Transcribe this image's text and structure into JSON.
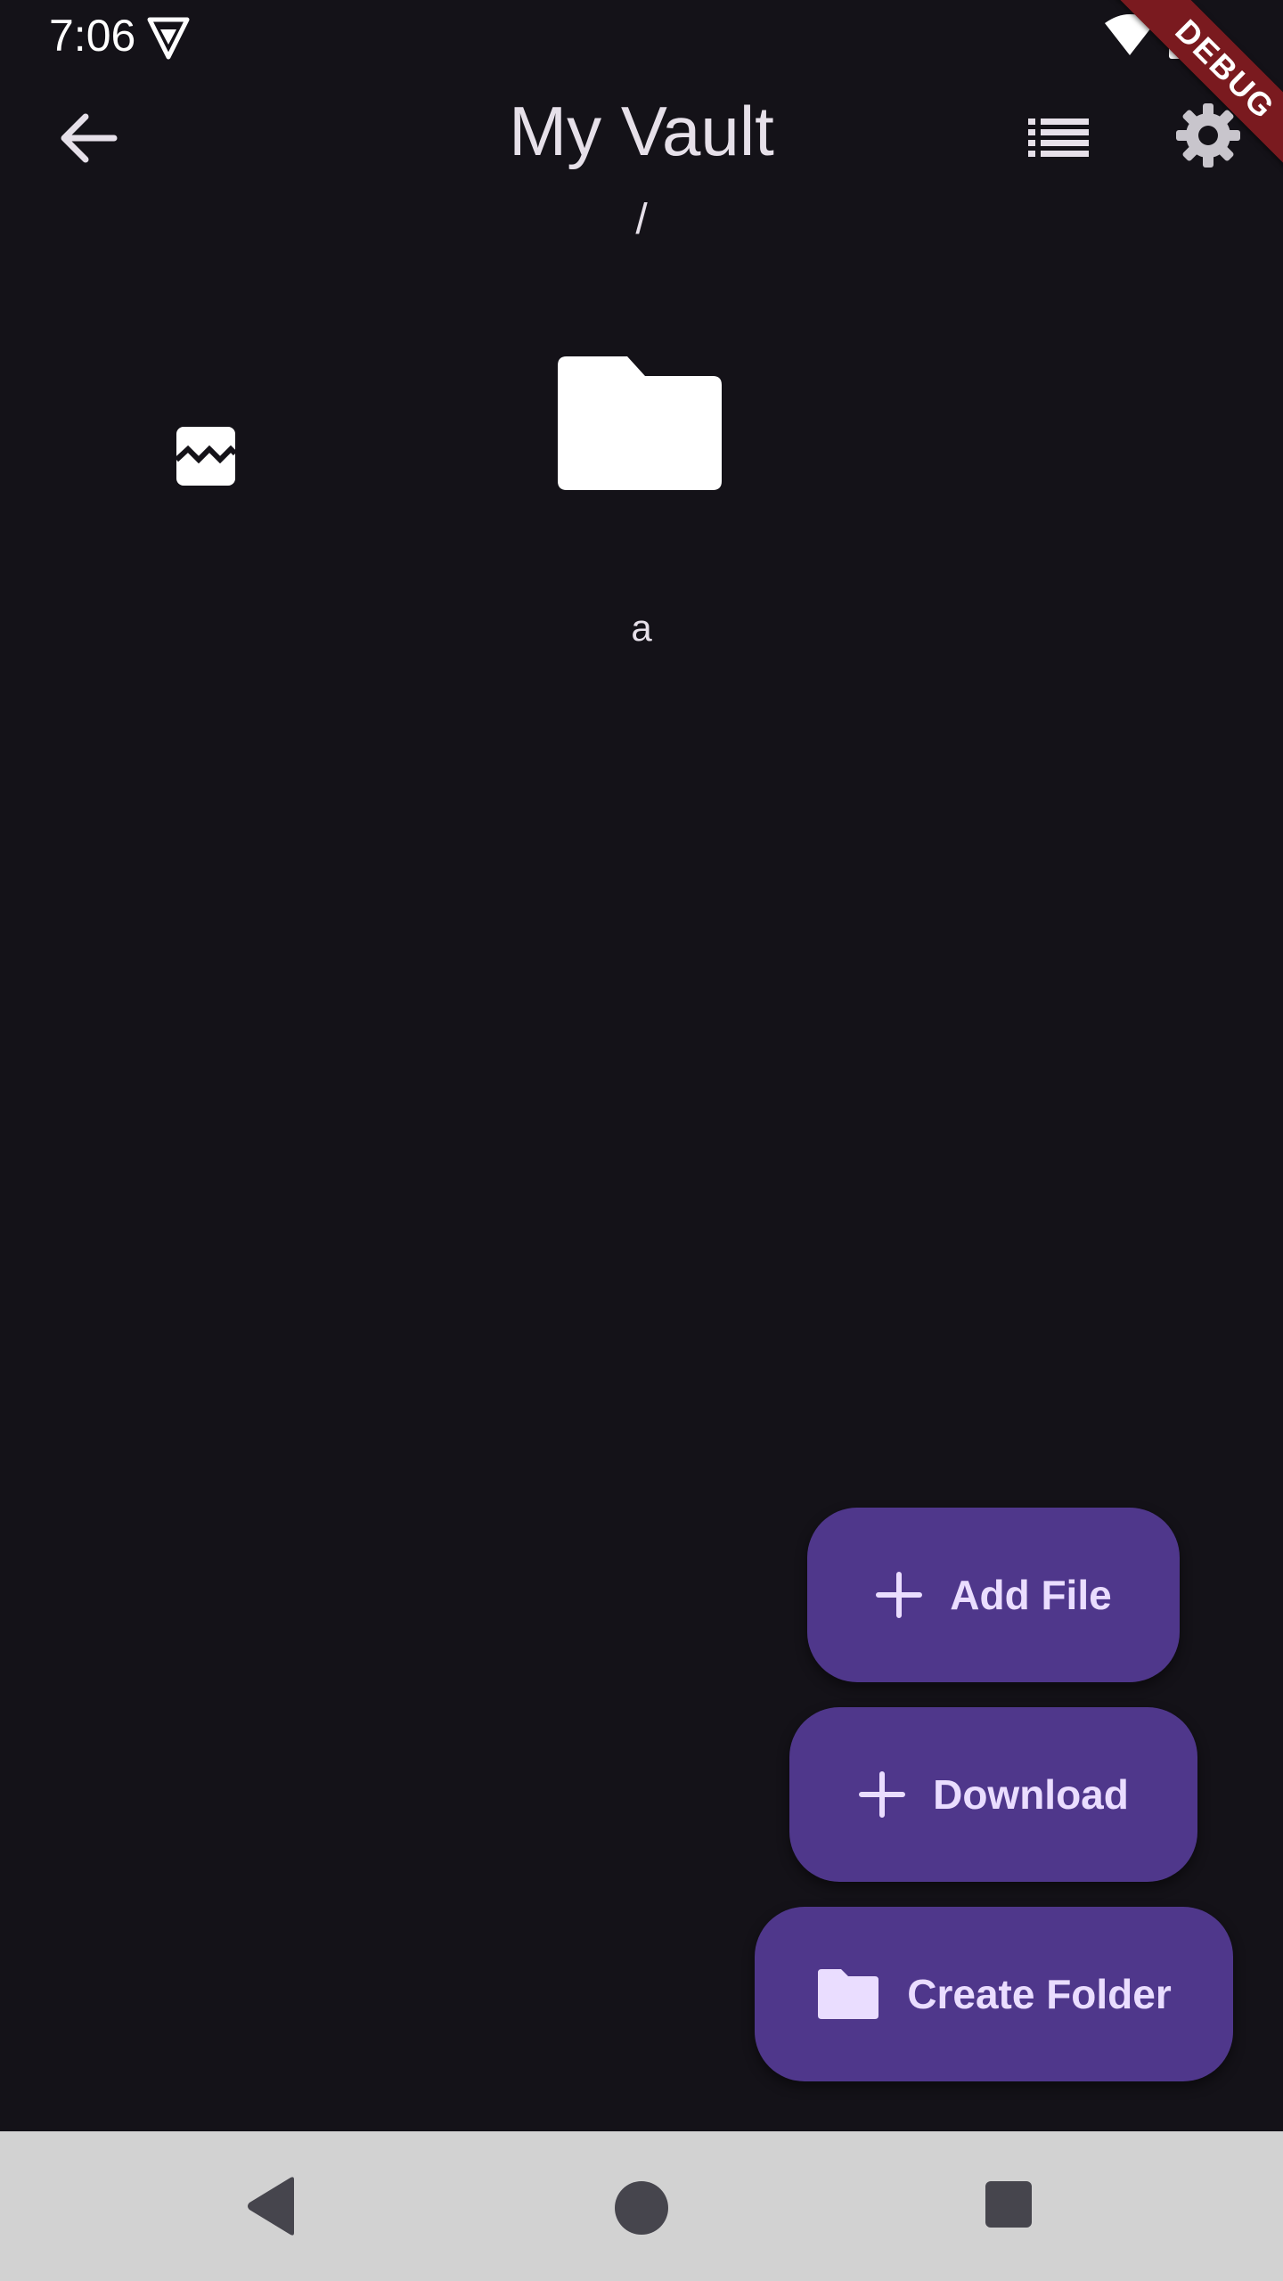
{
  "status_bar": {
    "time": "7:06",
    "icons": [
      "vpn-icon",
      "wifi-icon",
      "battery-icon"
    ]
  },
  "debug_banner": {
    "label": "DEBUG",
    "color": "#7a1a1f"
  },
  "app_bar": {
    "title": "My Vault",
    "back_icon": "arrow-back-icon",
    "view_toggle_icon": "list-view-icon",
    "settings_icon": "gear-icon"
  },
  "path": "/",
  "items": [
    {
      "type": "image",
      "icon": "broken-image-icon",
      "label": ""
    },
    {
      "type": "folder",
      "icon": "folder-icon",
      "label": "a"
    }
  ],
  "fabs": {
    "add_file": {
      "label": "Add File",
      "icon": "plus-icon"
    },
    "download": {
      "label": "Download",
      "icon": "plus-icon"
    },
    "create_folder": {
      "label": "Create Folder",
      "icon": "folder-icon"
    }
  },
  "nav_bar": {
    "back_icon": "nav-back-icon",
    "home_icon": "nav-home-icon",
    "recents_icon": "nav-recents-icon"
  },
  "colors": {
    "background": "#141218",
    "fab": "#4f378b",
    "fab_text": "#eaddff",
    "nav_bar": "#d2d2d2",
    "text": "#e6e0e9"
  }
}
